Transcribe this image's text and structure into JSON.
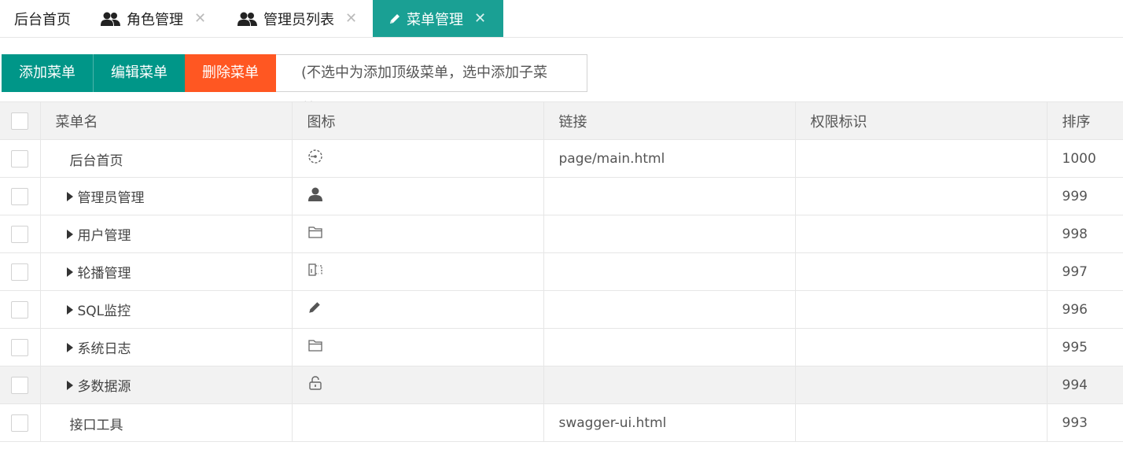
{
  "tabs": [
    {
      "label": "后台首页",
      "icon": "none",
      "closable": false,
      "active": false
    },
    {
      "label": "角色管理",
      "icon": "users-icon",
      "closable": true,
      "active": false
    },
    {
      "label": "管理员列表",
      "icon": "users-icon",
      "closable": true,
      "active": false
    },
    {
      "label": "菜单管理",
      "icon": "pencil-icon",
      "closable": true,
      "active": true
    }
  ],
  "close_glyph": "✕",
  "toolbar": {
    "add_label": "添加菜单",
    "edit_label": "编辑菜单",
    "delete_label": "删除菜单",
    "hint": "(不选中为添加顶级菜单，选中添加子菜单)"
  },
  "table": {
    "headers": {
      "name": "菜单名",
      "icon": "图标",
      "link": "链接",
      "perm": "权限标识",
      "sort": "排序"
    },
    "rows": [
      {
        "name": "后台首页",
        "expandable": false,
        "icon": "dashboard-icon",
        "link": "page/main.html",
        "perm": "",
        "sort": "1000",
        "highlighted": false
      },
      {
        "name": "管理员管理",
        "expandable": true,
        "icon": "user-icon",
        "link": "",
        "perm": "",
        "sort": "999",
        "highlighted": false
      },
      {
        "name": "用户管理",
        "expandable": true,
        "icon": "folder-icon",
        "link": "",
        "perm": "",
        "sort": "998",
        "highlighted": false
      },
      {
        "name": "轮播管理",
        "expandable": true,
        "icon": "carousel-icon",
        "link": "",
        "perm": "",
        "sort": "997",
        "highlighted": false
      },
      {
        "name": "SQL监控",
        "expandable": true,
        "icon": "pencil-icon",
        "link": "",
        "perm": "",
        "sort": "996",
        "highlighted": false
      },
      {
        "name": "系统日志",
        "expandable": true,
        "icon": "folder-icon",
        "link": "",
        "perm": "",
        "sort": "995",
        "highlighted": false
      },
      {
        "name": "多数据源",
        "expandable": true,
        "icon": "unlock-icon",
        "link": "",
        "perm": "",
        "sort": "994",
        "highlighted": true
      },
      {
        "name": "接口工具",
        "expandable": false,
        "icon": "none",
        "link": "swagger-ui.html",
        "perm": "",
        "sort": "993",
        "highlighted": false
      }
    ]
  },
  "colors": {
    "teal": "#009688",
    "active_tab": "#1aa094",
    "orange": "#ff5722"
  }
}
